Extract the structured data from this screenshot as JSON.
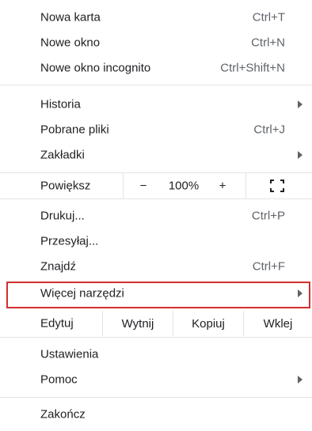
{
  "menu": {
    "new_tab": {
      "label": "Nowa karta",
      "shortcut": "Ctrl+T"
    },
    "new_window": {
      "label": "Nowe okno",
      "shortcut": "Ctrl+N"
    },
    "incognito": {
      "label": "Nowe okno incognito",
      "shortcut": "Ctrl+Shift+N"
    },
    "history": {
      "label": "Historia"
    },
    "downloads": {
      "label": "Pobrane pliki",
      "shortcut": "Ctrl+J"
    },
    "bookmarks": {
      "label": "Zakładki"
    },
    "zoom": {
      "label": "Powiększ",
      "minus": "−",
      "value": "100%",
      "plus": "+"
    },
    "print": {
      "label": "Drukuj...",
      "shortcut": "Ctrl+P"
    },
    "cast": {
      "label": "Przesyłaj..."
    },
    "find": {
      "label": "Znajdź",
      "shortcut": "Ctrl+F"
    },
    "more_tools": {
      "label": "Więcej narzędzi"
    },
    "edit": {
      "label": "Edytuj",
      "cut": "Wytnij",
      "copy": "Kopiuj",
      "paste": "Wklej"
    },
    "settings": {
      "label": "Ustawienia"
    },
    "help": {
      "label": "Pomoc"
    },
    "exit": {
      "label": "Zakończ"
    }
  },
  "highlight_color": "#d32f2f"
}
